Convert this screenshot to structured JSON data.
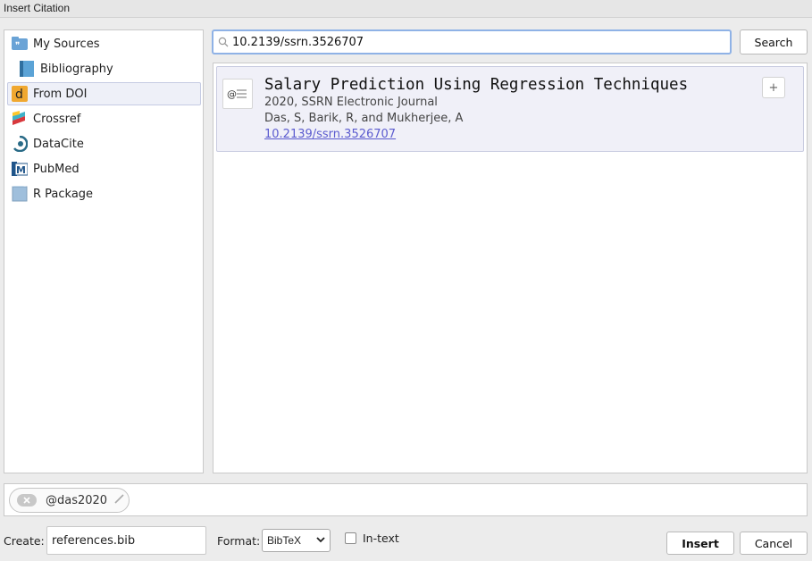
{
  "window": {
    "title": "Insert Citation"
  },
  "sidebar": {
    "items": [
      {
        "label": "My Sources",
        "icon": "quote-folder-icon"
      },
      {
        "label": "Bibliography",
        "icon": "book-icon"
      },
      {
        "label": "From DOI",
        "icon": "doi-icon",
        "selected": true
      },
      {
        "label": "Crossref",
        "icon": "crossref-icon"
      },
      {
        "label": "DataCite",
        "icon": "datacite-icon"
      },
      {
        "label": "PubMed",
        "icon": "pubmed-icon"
      },
      {
        "label": "R Package",
        "icon": "r-package-icon"
      }
    ]
  },
  "search": {
    "value": "10.2139/ssrn.3526707",
    "button_label": "Search"
  },
  "results": [
    {
      "title": "Salary Prediction Using Regression Techniques",
      "year_journal": "2020, SSRN Electronic Journal",
      "authors": "Das, S, Barik, R, and Mukherjee, A",
      "doi": "10.2139/ssrn.3526707",
      "add_label": "+"
    }
  ],
  "selected_citations": [
    {
      "key": "@das2020"
    }
  ],
  "footer": {
    "create_label": "Create:",
    "create_value": "references.bib",
    "format_label": "Format:",
    "format_value": "BibTeX",
    "intext_label": "In-text",
    "intext_checked": false,
    "insert_label": "Insert",
    "cancel_label": "Cancel"
  },
  "colors": {
    "accent_border": "#8fb2e6",
    "selected_bg": "#eef0f8",
    "link": "#5b5bcf"
  }
}
